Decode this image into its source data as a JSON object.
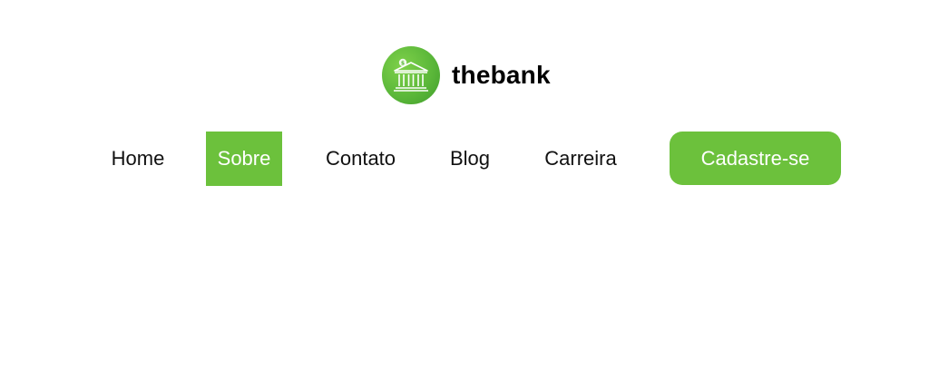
{
  "brand": {
    "name": "thebank",
    "logo_icon": "bank-building-icon",
    "logo_color": "#5cb83a"
  },
  "nav": {
    "items": [
      {
        "label": "Home",
        "active": false
      },
      {
        "label": "Sobre",
        "active": true
      },
      {
        "label": "Contato",
        "active": false
      },
      {
        "label": "Blog",
        "active": false
      },
      {
        "label": "Carreira",
        "active": false
      }
    ],
    "active_color": "#6cc13c"
  },
  "cta": {
    "label": "Cadastre-se",
    "color": "#6cc13c"
  }
}
